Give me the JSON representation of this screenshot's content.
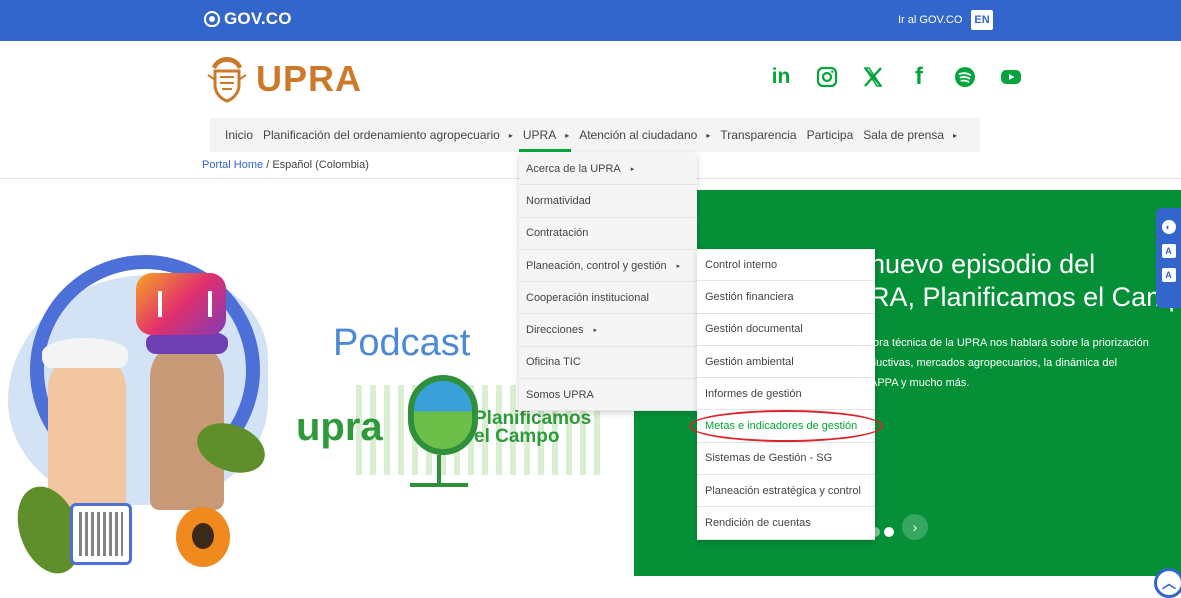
{
  "gov_bar": {
    "logo_text": "GOV.CO",
    "link": "Ir al GOV.CO",
    "lang": "EN",
    "bg_color": "#3366cc"
  },
  "brand": {
    "name": "UPRA",
    "accent_color": "#cc7a2a",
    "socials": [
      {
        "icon": "linkedin-icon",
        "glyph": "in"
      },
      {
        "icon": "instagram-icon",
        "glyph": ""
      },
      {
        "icon": "x-icon",
        "glyph": "𝕏"
      },
      {
        "icon": "facebook-icon",
        "glyph": "f"
      },
      {
        "icon": "spotify-icon",
        "glyph": ""
      },
      {
        "icon": "youtube-icon",
        "glyph": ""
      }
    ],
    "social_color": "#05a43c"
  },
  "nav": {
    "items": [
      {
        "label": "Inicio",
        "has_caret": false
      },
      {
        "label": "Planificación del ordenamiento agropecuario",
        "has_caret": true
      },
      {
        "label": "UPRA",
        "has_caret": true,
        "active": true
      },
      {
        "label": "Atención al ciudadano",
        "has_caret": true
      },
      {
        "label": "Transparencia",
        "has_caret": false
      },
      {
        "label": "Participa",
        "has_caret": false
      },
      {
        "label": "Sala de prensa",
        "has_caret": true
      }
    ],
    "caret_glyph": "▸"
  },
  "breadcrumb": {
    "home": "Portal Home",
    "separator": " / ",
    "current": "Español (Colombia)"
  },
  "hero_left": {
    "podcast": "Podcast",
    "upra": "upra",
    "planificamos": "Planificamos",
    "el_campo": "el Campo"
  },
  "hero_right": {
    "title_line1": "nuevo episodio del",
    "title_line2": "RA, Planificamos el Campo",
    "desc_line1": "tora técnica de la UPRA nos hablará sobre la priorización",
    "desc_line2": "ductivas, mercados agropecuarios, la dinámica del",
    "desc_line3": "APPA y mucho más.",
    "bg_color": "#059038",
    "next_glyph": "›"
  },
  "menu_upra": {
    "items": [
      {
        "label": "Acerca de la UPRA",
        "has_caret": true
      },
      {
        "label": "Normatividad",
        "has_caret": false
      },
      {
        "label": "Contratación",
        "has_caret": false
      },
      {
        "label": "Planeación, control y gestión",
        "has_caret": true
      },
      {
        "label": "Cooperación institucional",
        "has_caret": false
      },
      {
        "label": "Direcciones",
        "has_caret": true
      },
      {
        "label": "Oficina TIC",
        "has_caret": false
      },
      {
        "label": "Somos UPRA",
        "has_caret": false
      }
    ]
  },
  "menu_planeacion": {
    "items": [
      {
        "label": "Control interno"
      },
      {
        "label": "Gestión financiera"
      },
      {
        "label": "Gestión documental"
      },
      {
        "label": "Gestión ambiental"
      },
      {
        "label": "Informes de gestión"
      },
      {
        "label": "Metas e indicadores de gestión",
        "highlighted": true
      },
      {
        "label": "Sistemas de Gestión - SG"
      },
      {
        "label": "Planeación estratégica y control"
      },
      {
        "label": "Rendición de cuentas"
      }
    ],
    "highlight_color": "#d9252d"
  },
  "a11y": {
    "contrast": "◐",
    "decrease": "A",
    "increase": "A"
  },
  "scroll_top_glyph": "︿"
}
